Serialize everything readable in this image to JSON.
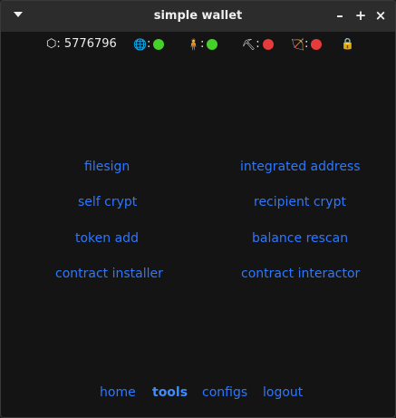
{
  "window": {
    "title": "simple wallet",
    "controls": {
      "minimize": "–",
      "maximize": "+",
      "close": "×"
    },
    "menu_icon": "chevron-down-icon"
  },
  "status": {
    "height_symbol": "⬡:",
    "height_value": "5776796",
    "network": {
      "icon": "globe-icon",
      "glyph": "🌐",
      "sep": ":",
      "color": "#45d12a"
    },
    "daemon": {
      "icon": "person-icon",
      "glyph": "🧍",
      "sep": ":",
      "color": "#45d12a"
    },
    "mining": {
      "icon": "pickaxe-icon",
      "glyph": "⛏",
      "sep": ":",
      "color": "#e63b3b"
    },
    "staking": {
      "icon": "bow-icon",
      "glyph": "🏹",
      "sep": ":",
      "color": "#e63b3b"
    },
    "lock": {
      "icon": "lock-icon",
      "glyph": "🔒",
      "color": "#f5a623"
    }
  },
  "tools": {
    "filesign": "filesign",
    "integrated_address": "integrated address",
    "self_crypt": "self crypt",
    "recipient_crypt": "recipient crypt",
    "token_add": "token add",
    "balance_rescan": "balance rescan",
    "contract_installer": "contract installer",
    "contract_interactor": "contract interactor"
  },
  "nav": {
    "home": "home",
    "tools": "tools",
    "configs": "configs",
    "logout": "logout",
    "active": "tools"
  },
  "colors": {
    "link": "#2e77ff",
    "background": "#141414",
    "titlebar": "#2c2c2c"
  }
}
